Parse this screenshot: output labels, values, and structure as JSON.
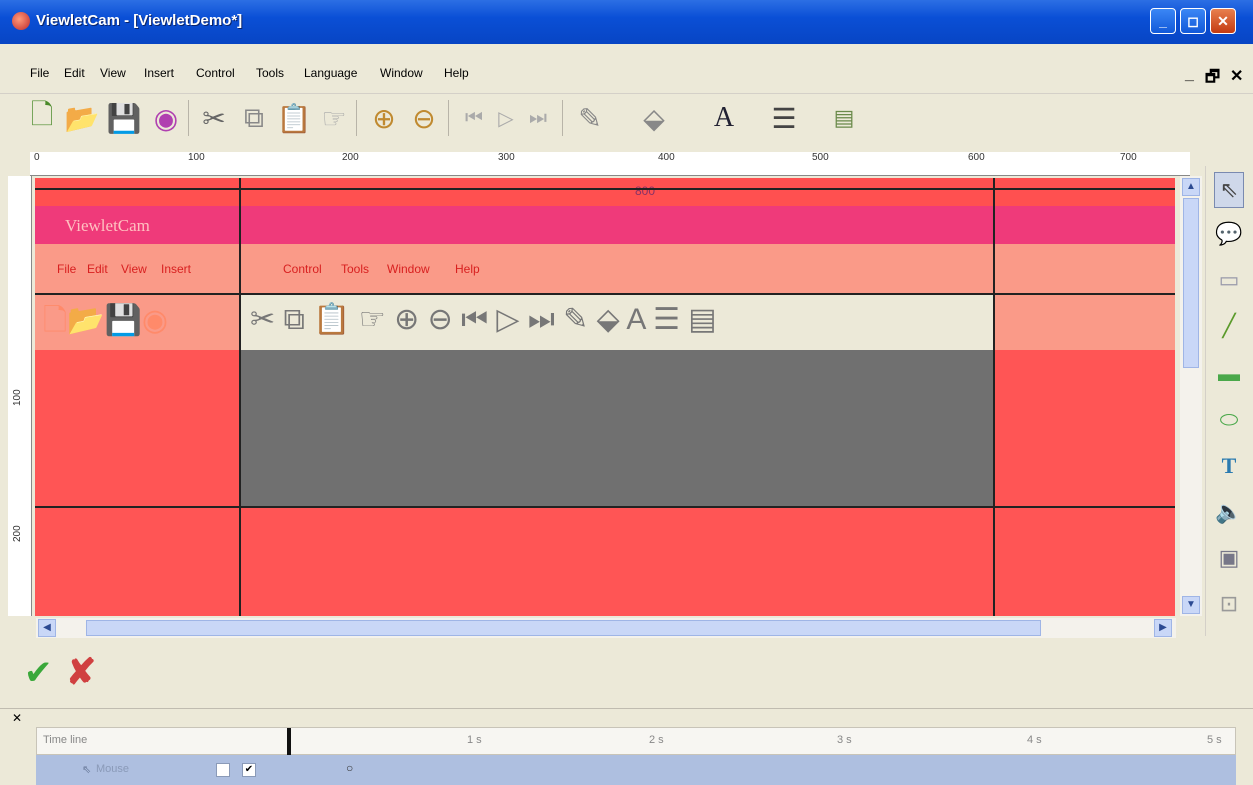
{
  "window": {
    "title": "ViewletCam - [ViewletDemo*]",
    "min_label": "_",
    "max_label": "◻",
    "close_label": "✕"
  },
  "menu": {
    "items": [
      "File",
      "Edit",
      "View",
      "Insert",
      "Control",
      "Tools",
      "Language",
      "Window",
      "Help"
    ],
    "mdi_min": "_",
    "mdi_restore": "🗗",
    "mdi_close": "✕"
  },
  "toolbar": {
    "icons": [
      "new-icon",
      "open-icon",
      "save-icon",
      "record-icon",
      "cut-icon",
      "copy-icon",
      "paste-icon",
      "paste-special-icon",
      "zoom-in-icon",
      "zoom-out-icon",
      "first-frame-icon",
      "play-icon",
      "last-frame-icon",
      "line-color-icon",
      "fill-color-icon",
      "font-color-icon",
      "line-style-icon",
      "properties-icon"
    ]
  },
  "ruler": {
    "h_labels": [
      "0",
      "100",
      "200",
      "300",
      "400",
      "500",
      "600",
      "700"
    ],
    "v_labels": [
      "100",
      "200"
    ]
  },
  "canvas": {
    "width_label": "800",
    "app_title": "ViewletCam",
    "menu_items": [
      "File",
      "Edit",
      "View",
      "Insert",
      "Control",
      "Tools",
      "Window",
      "Help"
    ]
  },
  "actions": {
    "ok_icon": "check-icon",
    "cancel_icon": "x-icon"
  },
  "timeline": {
    "header": "Time line",
    "marks": [
      "1 s",
      "2 s",
      "3 s",
      "4 s",
      "5 s"
    ],
    "row_label": "Mouse",
    "row_checked": true
  },
  "colors": {
    "titlebar": "#0a4fd6",
    "canvas_red": "#ff5555",
    "canvas_pink": "#ef3a7a",
    "canvas_menu": "#fa9a88",
    "canvas_gray": "#707070"
  }
}
